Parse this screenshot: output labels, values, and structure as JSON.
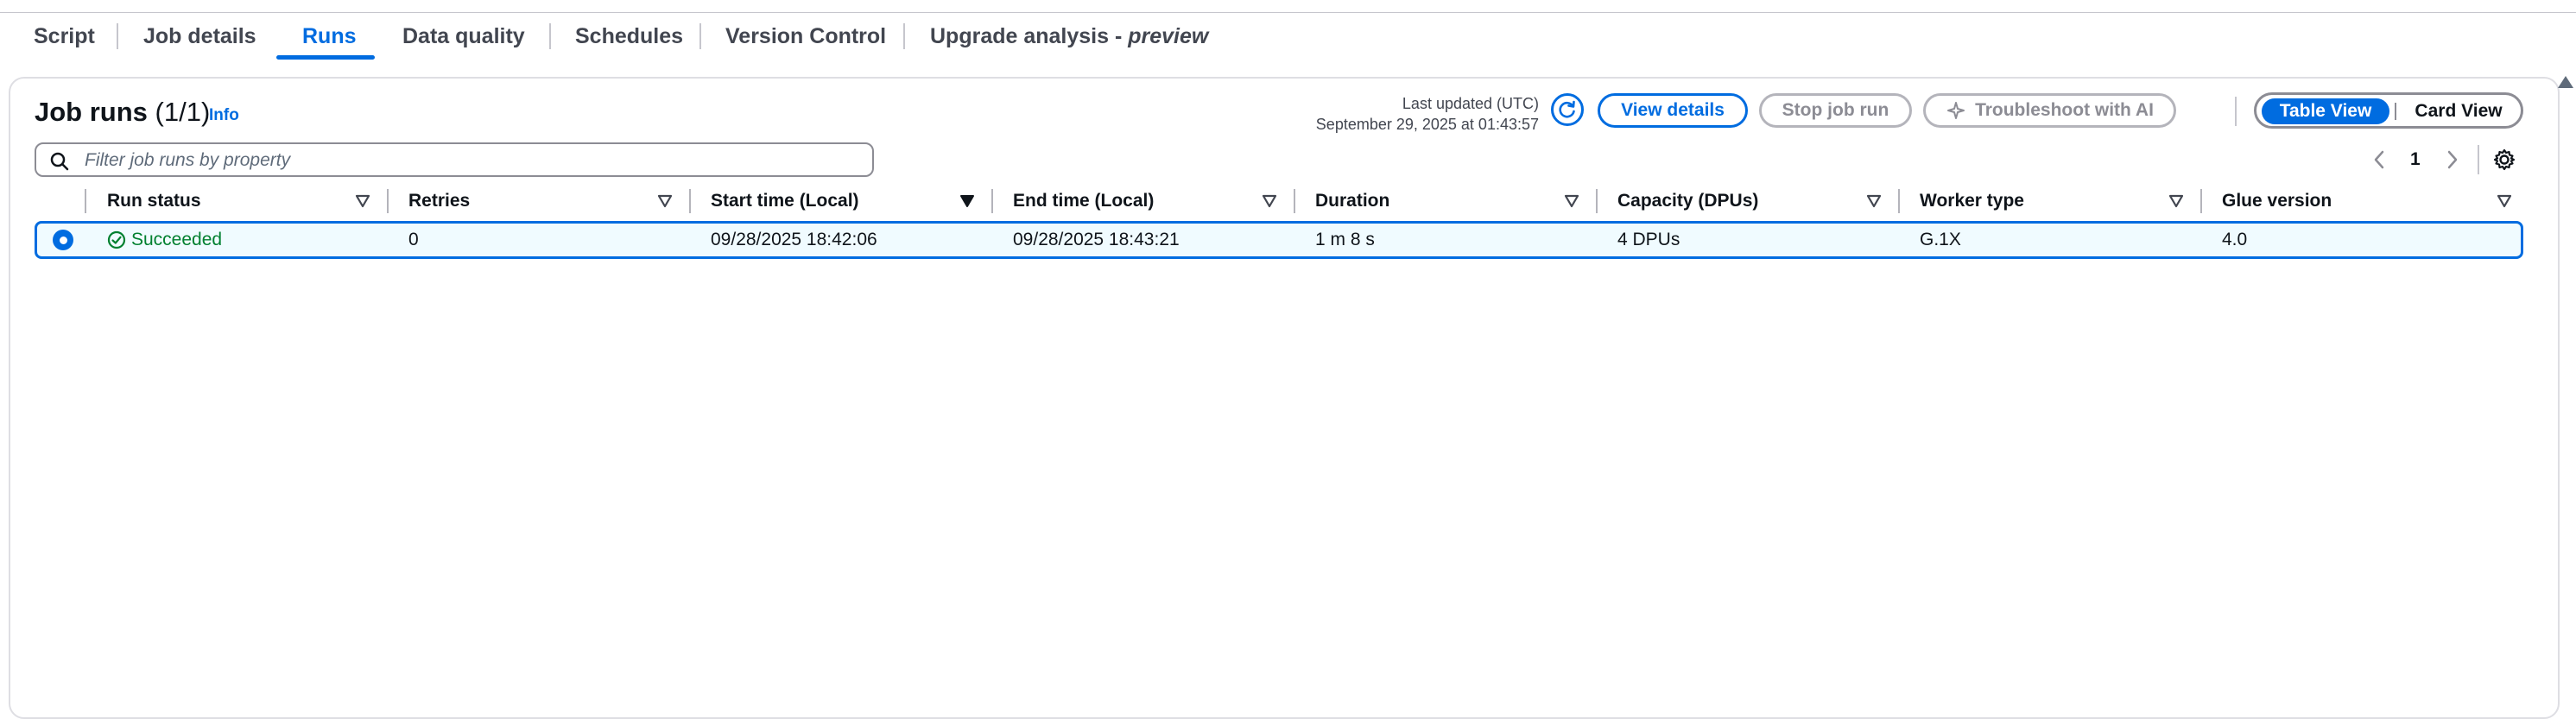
{
  "tabs": [
    {
      "label": "Script"
    },
    {
      "label": "Job details"
    },
    {
      "label": "Runs"
    },
    {
      "label": "Data quality"
    },
    {
      "label": "Schedules"
    },
    {
      "label": "Version Control"
    },
    {
      "label": "Upgrade analysis - ",
      "suffix": "preview"
    }
  ],
  "active_tab": "Runs",
  "header": {
    "title": "Job runs",
    "count": "(1/1)",
    "info": "Info",
    "last_updated_label": "Last updated (UTC)",
    "last_updated_value": "September 29, 2025 at 01:43:57"
  },
  "actions": {
    "view_details": "View details",
    "stop_job_run": "Stop job run",
    "troubleshoot": "Troubleshoot with AI"
  },
  "view_toggle": {
    "table": "Table View",
    "card": "Card View",
    "selected": "Table View"
  },
  "search": {
    "placeholder": "Filter job runs by property",
    "value": ""
  },
  "pagination": {
    "current_page": "1"
  },
  "table": {
    "columns": [
      "Run status",
      "Retries",
      "Start time (Local)",
      "End time (Local)",
      "Duration",
      "Capacity (DPUs)",
      "Worker type",
      "Glue version"
    ],
    "sorted_column": "Start time (Local)",
    "rows": [
      {
        "selected": true,
        "run_status": "Succeeded",
        "retries": "0",
        "start_time": "09/28/2025 18:42:06",
        "end_time": "09/28/2025 18:43:21",
        "duration": "1 m 8 s",
        "capacity": "4 DPUs",
        "worker_type": "G.1X",
        "glue_version": "4.0"
      }
    ]
  },
  "colors": {
    "accent": "#006ce0",
    "success": "#00802f",
    "disabled": "#8c8c94",
    "row_selected_bg": "#f0fbff"
  },
  "icons": [
    "refresh-icon",
    "sparkle-icon",
    "search-icon",
    "chevron-left-icon",
    "chevron-right-icon",
    "settings-gear-icon",
    "sort-down-icon",
    "success-check-icon",
    "radio-selected-icon",
    "scroll-up-arrow-icon"
  ]
}
